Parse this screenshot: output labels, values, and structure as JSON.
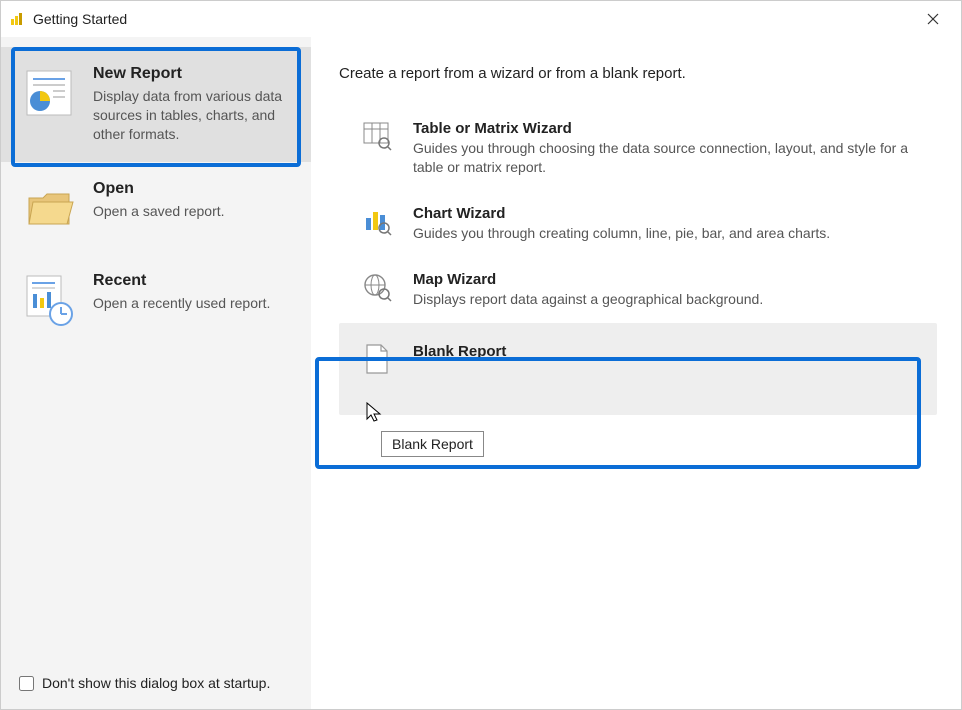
{
  "window": {
    "title": "Getting Started"
  },
  "sidebar": {
    "items": [
      {
        "title": "New Report",
        "desc": "Display data from various data sources in tables, charts, and other formats."
      },
      {
        "title": "Open",
        "desc": "Open a saved report."
      },
      {
        "title": "Recent",
        "desc": "Open a recently used report."
      }
    ]
  },
  "main": {
    "heading": "Create a report from a wizard or from a blank report.",
    "options": [
      {
        "title": "Table or Matrix Wizard",
        "desc": "Guides you through choosing the data source connection, layout, and style for a table or matrix report."
      },
      {
        "title": "Chart Wizard",
        "desc": "Guides you through creating column, line, pie, bar, and area charts."
      },
      {
        "title": "Map Wizard",
        "desc": "Displays report data against a geographical background."
      },
      {
        "title": "Blank Report",
        "desc": ""
      }
    ],
    "tooltip": "Blank Report"
  },
  "footer": {
    "checkbox_label": "Don't show this dialog box at startup."
  }
}
